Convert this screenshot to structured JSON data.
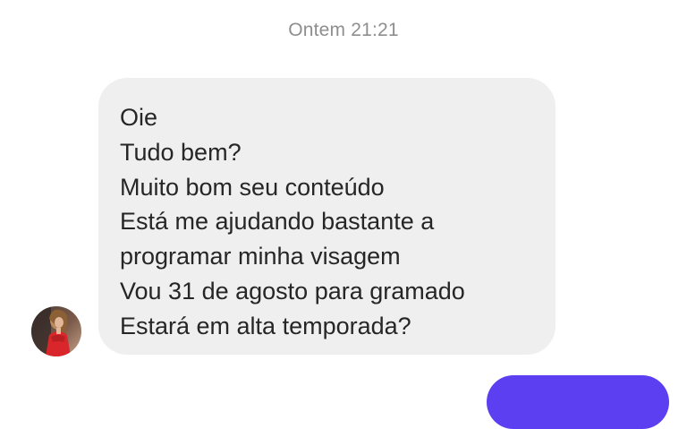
{
  "chat": {
    "timestamp": "Ontem 21:21",
    "received_message": {
      "lines": [
        "Oie",
        "Tudo bem?",
        "Muito bom seu conteúdo",
        "Está me ajudando bastante a",
        "programar minha visagem",
        "Vou 31 de agosto para gramado",
        "Estará em alta temporada?"
      ]
    }
  },
  "colors": {
    "background": "#ffffff",
    "received_bubble": "#efefef",
    "message_text": "#262626",
    "timestamp_text": "#8e8e8e",
    "sent_bubble": "#5b3ff0"
  },
  "icons": {
    "avatar": "profile-photo"
  }
}
